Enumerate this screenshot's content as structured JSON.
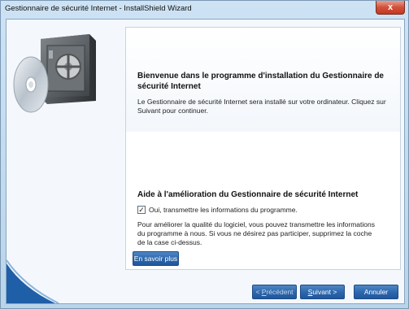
{
  "window": {
    "title": "Gestionnaire de sécurité Internet - InstallShield Wizard",
    "close_glyph": "x"
  },
  "icons": [
    "safe-icon",
    "cd-disc-icon",
    "close-icon"
  ],
  "colors": {
    "button_blue": "#2b66ad",
    "title_bar": "#cde3f4",
    "panel": "#ffffff"
  },
  "welcome": {
    "title": "Bienvenue dans le programme d'installation du Gestionnaire de sécurité Internet",
    "body": "Le Gestionnaire de sécurité Internet sera installé sur votre ordinateur. Cliquez sur Suivant pour continuer."
  },
  "aide": {
    "title": "Aide à l'amélioration du Gestionnaire de sécurité Internet",
    "checkbox_label": "Oui, transmettre les informations du programme.",
    "checkbox_checked": true,
    "body": "Pour améliorer la qualité du logiciel, vous pouvez transmettre les informations du programme à nous. Si vous ne désirez pas participer, supprimez la coche de la case ci-dessus."
  },
  "buttons": {
    "info": "En savoir plus",
    "prev_prefix": "< ",
    "prev_u": "P",
    "prev_rest": "récédent",
    "next_u": "S",
    "next_rest": "uivant >",
    "cancel": "Annuler"
  }
}
